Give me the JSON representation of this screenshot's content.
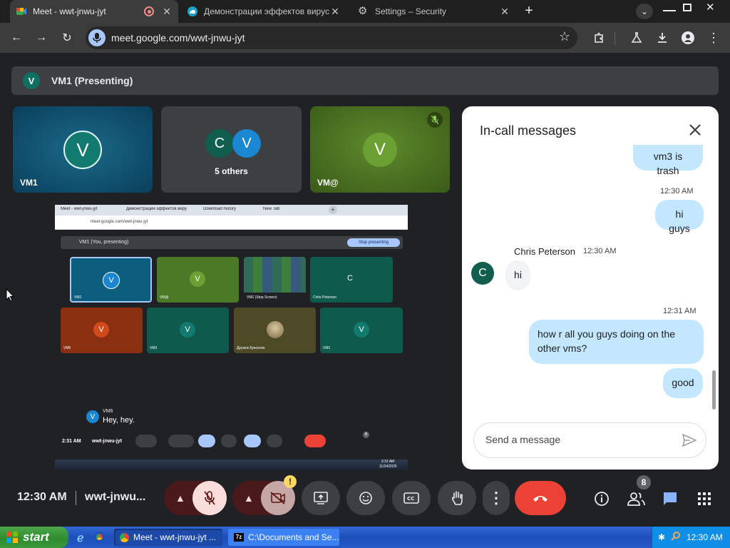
{
  "browser": {
    "tabs": [
      {
        "title": "Meet - wwt-jnwu-jyt",
        "active": true
      },
      {
        "title": "Демонстрации эффектов вирусов",
        "active": false
      },
      {
        "title": "Settings – Security",
        "active": false
      }
    ],
    "url": "meet.google.com/wwt-jnwu-jyt"
  },
  "meet": {
    "presenting_avatar": "V",
    "presenting_label": "VM1 (Presenting)",
    "tiles": [
      {
        "avatar": "V",
        "name": "VM1"
      },
      {
        "avatar_c": "C",
        "avatar_v": "V",
        "name": "5 others"
      },
      {
        "avatar": "V",
        "name": "VM@",
        "muted": true
      }
    ],
    "meeting_time": "12:30 AM",
    "meeting_code": "wwt-jnwu...",
    "people_count": "8",
    "camera_alert": "!"
  },
  "shared_screen": {
    "tabs": [
      "Meet - wwt-jnwu-jyt",
      "Демонстрации эффектов вирусов",
      "Download history",
      "New Tab"
    ],
    "url": "meet.google.com/wwt-jnwu-jyt",
    "presenting_label": "VM1 (You, presenting)",
    "stop_label": "Stop presenting",
    "tiles": [
      {
        "avatar": "V",
        "name": "VM1"
      },
      {
        "avatar": "V",
        "name": "VM@"
      },
      {
        "avatar": "",
        "name": "VM1 (Stop Screen)"
      },
      {
        "avatar": "C",
        "name": "Chris Peterson"
      },
      {
        "avatar": "V",
        "name": "VM5"
      },
      {
        "avatar": "V",
        "name": "VM3"
      },
      {
        "avatar": "",
        "name": "Дружок Букохсин"
      },
      {
        "avatar": "V",
        "name": "VM1"
      }
    ],
    "notif_avatar": "V",
    "notif_name": "VM6",
    "notif_text": "Hey, hey.",
    "time": "2:31 AM",
    "code": "wwt-jnwu-jyt",
    "people_count": "8",
    "tray_time": "2:31 AM",
    "tray_date": "11/24/2025"
  },
  "chat": {
    "title": "In-call messages",
    "messages": [
      {
        "text": "vm3 is trash"
      },
      {
        "time": "12:30 AM",
        "text": "hi guys"
      },
      {
        "sender": "Chris Peterson",
        "sender_initial": "C",
        "time": "12:30 AM",
        "text": "hi"
      },
      {
        "time": "12:31 AM",
        "text": "how r all you guys doing on the other vms?"
      },
      {
        "text": "good"
      }
    ],
    "input_placeholder": "Send a message"
  },
  "taskbar": {
    "start_label": "start",
    "items": [
      "Meet - wwt-jnwu-jyt ...",
      "C:\\Documents and Se..."
    ],
    "clock": "12:30 AM"
  },
  "colors": {
    "accent": "#8ab4f8",
    "hangup": "#ea4335",
    "muted": "#f9dedc",
    "chat_bubble": "#c2e7ff",
    "meet_avatar_teal": "#0f7060",
    "xp_blue": "#2559c8",
    "xp_green": "#3a9a3a"
  }
}
